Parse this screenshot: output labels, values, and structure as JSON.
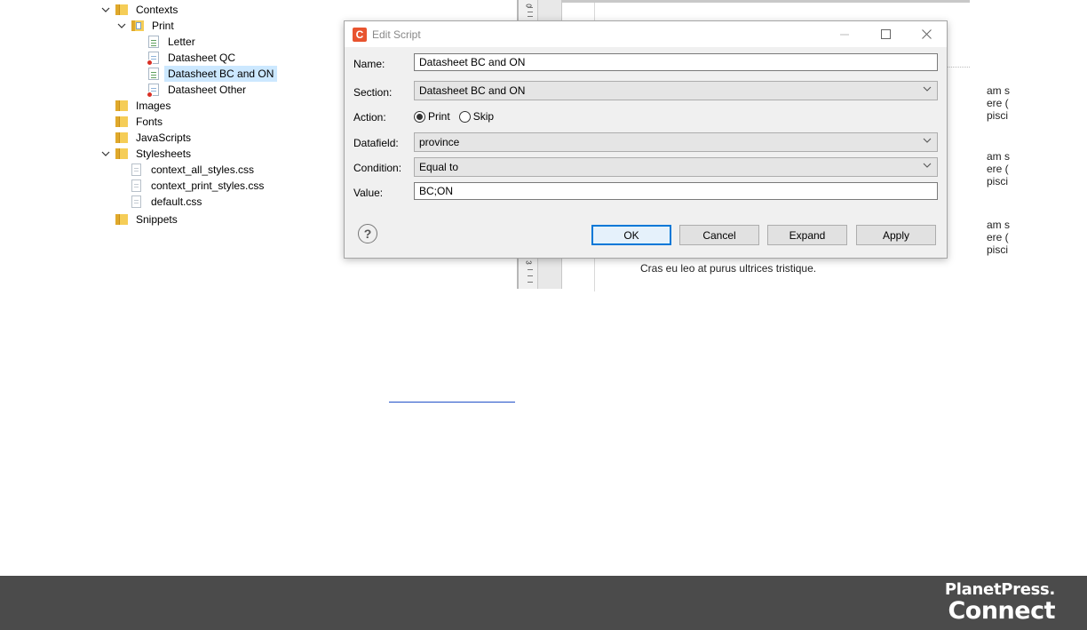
{
  "tree": {
    "contexts": "Contexts",
    "print": "Print",
    "letter": "Letter",
    "datasheet_qc": "Datasheet QC",
    "datasheet_bc_on": "Datasheet BC and ON",
    "datasheet_other": "Datasheet Other",
    "images": "Images",
    "fonts": "Fonts",
    "javascripts": "JavaScripts",
    "stylesheets": "Stylesheets",
    "css_all": "context_all_styles.css",
    "css_print": "context_print_styles.css",
    "css_default": "default.css",
    "snippets": "Snippets",
    "selected": "Datasheet BC and ON"
  },
  "editor": {
    "ruler_top": "0",
    "ruler_bottom": "3",
    "side_snippets": [
      [
        "am s",
        "ere (",
        "pisci"
      ],
      [
        "am s",
        "ere (",
        "pisci"
      ],
      [
        "am s",
        "ere (",
        "pisci"
      ]
    ],
    "bottom_line": "Cras eu leo at purus ultrices tristique."
  },
  "dialog": {
    "icon_letter": "C",
    "title": "Edit Script",
    "name_label": "Name:",
    "name_value": "Datasheet BC and ON",
    "section_label": "Section:",
    "section_value": "Datasheet BC and ON",
    "action_label": "Action:",
    "action_print": "Print",
    "action_skip": "Skip",
    "action_selected": "Print",
    "datafield_label": "Datafield:",
    "datafield_value": "province",
    "condition_label": "Condition:",
    "condition_value": "Equal to",
    "value_label": "Value:",
    "value_value": "BC;ON",
    "ok": "OK",
    "cancel": "Cancel",
    "expand": "Expand",
    "apply": "Apply"
  },
  "footer": {
    "brand_line1": "PlanetPress.",
    "brand_line2": "Connect",
    "background": "#4b4b4b"
  },
  "colors": {
    "selection": "#cce8ff",
    "accent": "#0078d7",
    "app_icon": "#e8542f",
    "link": "#2150c8"
  }
}
